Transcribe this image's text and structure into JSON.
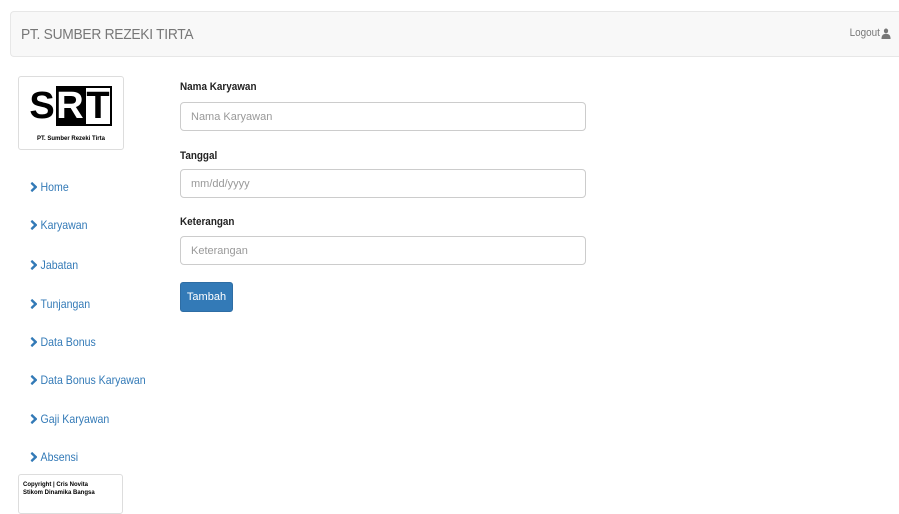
{
  "header": {
    "brand": "PT. SUMBER REZEKI TIRTA",
    "logout_label": "Logout"
  },
  "logo": {
    "letters": [
      "S",
      "R",
      "T"
    ],
    "subtitle": "PT. Sumber Rezeki Tirta"
  },
  "sidebar": {
    "items": [
      {
        "label": "Home"
      },
      {
        "label": "Karyawan"
      },
      {
        "label": "Jabatan"
      },
      {
        "label": "Tunjangan"
      },
      {
        "label": "Data Bonus"
      },
      {
        "label": "Data Bonus Karyawan"
      },
      {
        "label": "Gaji Karyawan"
      },
      {
        "label": "Absensi"
      }
    ],
    "copyright_line1": "Copyright | Cris Novita",
    "copyright_line2": "Stikom Dinamika Bangsa"
  },
  "form": {
    "nama_label": "Nama Karyawan",
    "nama_placeholder": "Nama Karyawan",
    "tanggal_label": "Tanggal",
    "tanggal_placeholder": "mm/dd/yyyy",
    "keterangan_label": "Keterangan",
    "keterangan_placeholder": "Keterangan",
    "submit_label": "Tambah"
  },
  "colors": {
    "link": "#337ab7",
    "button": "#337ab7",
    "navbar_bg": "#f8f8f8"
  }
}
